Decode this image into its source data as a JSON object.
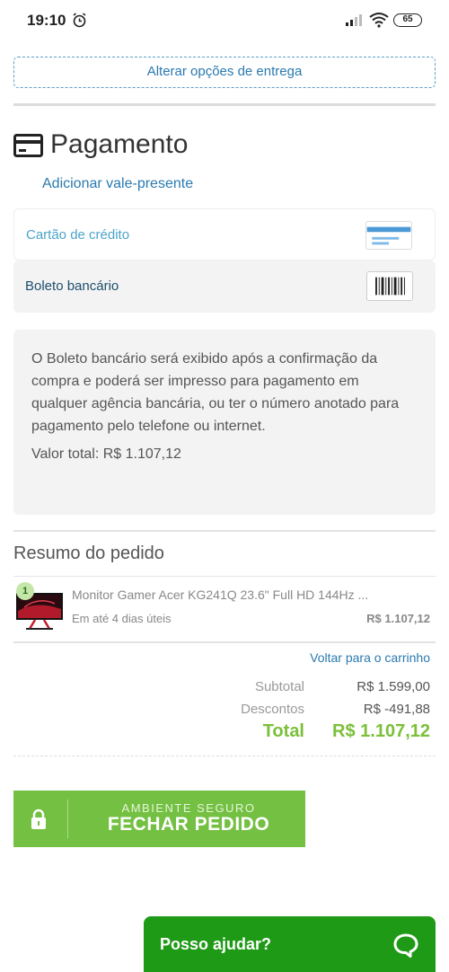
{
  "status_bar": {
    "time": "19:10",
    "battery": "65"
  },
  "delivery": {
    "change_options_label": "Alterar opções de entrega"
  },
  "payment": {
    "title": "Pagamento",
    "gift_card_link": "Adicionar vale-presente",
    "methods": [
      {
        "label": "Cartão de crédito",
        "icon": "credit-card-icon"
      },
      {
        "label": "Boleto bancário",
        "icon": "barcode-icon"
      }
    ],
    "boleto_info": "O Boleto bancário será exibido após a confirmação da compra e poderá ser impresso para pagamento em qualquer agência bancária, ou ter o número anotado para pagamento pelo telefone ou internet.",
    "total_label": "Valor total: R$ 1.107,12"
  },
  "summary": {
    "title": "Resumo do pedido",
    "items": [
      {
        "quantity": "1",
        "name": "Monitor Gamer Acer KG241Q 23.6\" Full HD 144Hz ...",
        "delivery": "Em até 4 dias úteis",
        "price": "R$ 1.107,12"
      }
    ],
    "back_to_cart": "Voltar para o carrinho",
    "subtotal_label": "Subtotal",
    "subtotal_value": "R$ 1.599,00",
    "discounts_label": "Descontos",
    "discounts_value": "R$ -491,88",
    "total_label": "Total",
    "total_value": "R$ 1.107,12"
  },
  "checkout": {
    "subtitle": "AMBIENTE SEGURO",
    "label": "FECHAR PEDIDO"
  },
  "help": {
    "label": "Posso ajudar?"
  },
  "colors": {
    "accent_blue": "#2a7ab0",
    "green": "#74c043",
    "chat_green": "#1f9a16",
    "total_green": "#7bbf3a"
  }
}
